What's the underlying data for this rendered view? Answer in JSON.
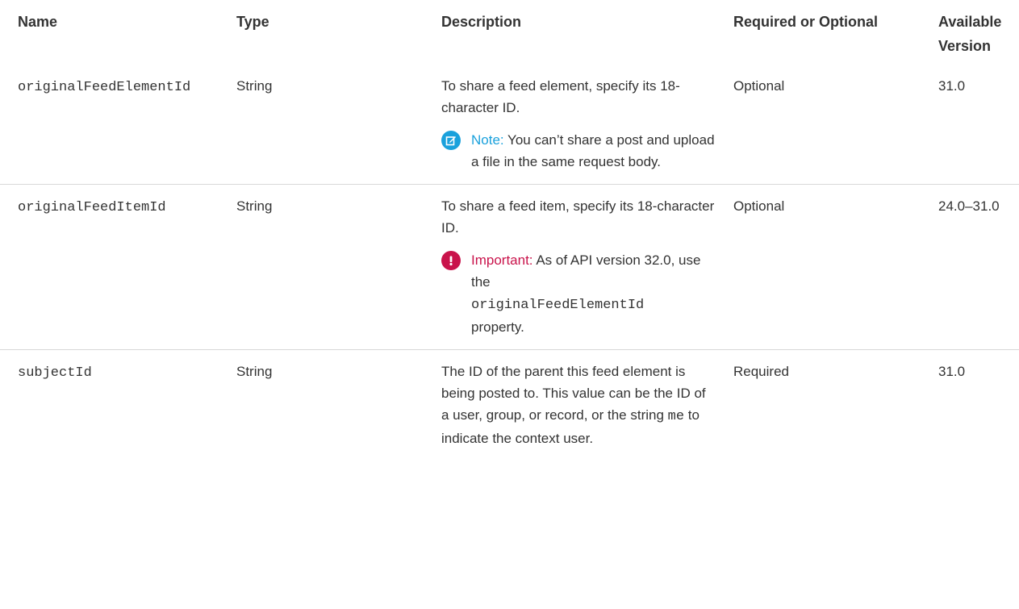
{
  "headers": {
    "name": "Name",
    "type": "Type",
    "description": "Description",
    "required": "Required or Optional",
    "version_line1": "Available",
    "version_line2": "Version"
  },
  "rows": [
    {
      "name": "originalFeedElementId",
      "type": "String",
      "description": "To share a feed element, specify its 18-character ID.",
      "callout": {
        "kind": "note",
        "icon": "note-edit-icon",
        "label": "Note:",
        "text": " You can’t share a post and upload a file in the same request body."
      },
      "required": "Optional",
      "version": "31.0"
    },
    {
      "name": "originalFeedItemId",
      "type": "String",
      "description": "To share a feed item, specify its 18-character ID.",
      "callout": {
        "kind": "important",
        "icon": "important-exclamation-icon",
        "label": "Important:",
        "text_before": " As of API version 32.0, use the",
        "code": "originalFeedElementId",
        "text_after": "property."
      },
      "required": "Optional",
      "version": "24.0–31.0"
    },
    {
      "name": "subjectId",
      "type": "String",
      "description_before": "The ID of the parent this feed element is being posted to. This value can be the ID of a user, group, or record, or the string",
      "description_code": "me",
      "description_after": "to indicate the context user.",
      "required": "Required",
      "version": "31.0"
    }
  ],
  "colors": {
    "note": "#1aa1dc",
    "important": "#c9134b",
    "text": "#333333",
    "divider": "#d8d8d8"
  }
}
